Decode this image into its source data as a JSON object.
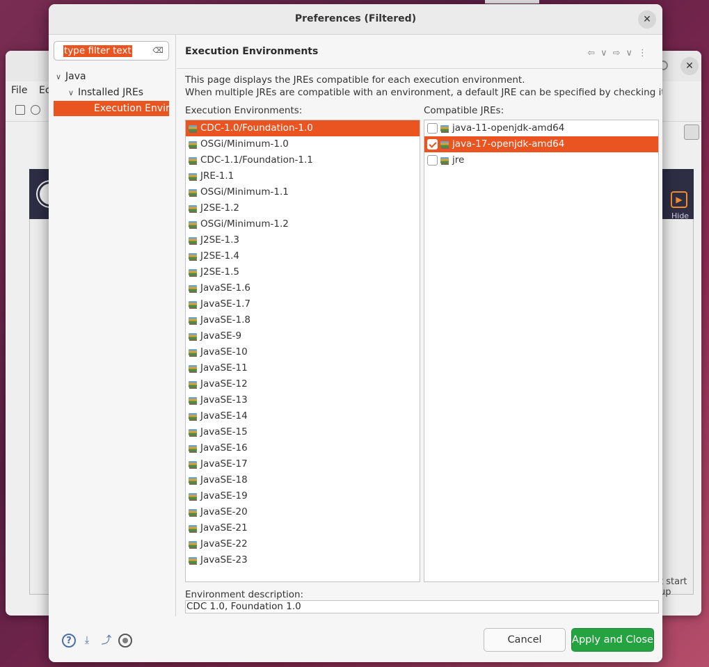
{
  "background_window": {
    "menu": [
      "File",
      "Ec"
    ],
    "hide_label": "Hide",
    "startup_text": "t start up"
  },
  "dialog": {
    "title": "Preferences (Filtered)",
    "close_glyph": "✕"
  },
  "nav": {
    "filter_placeholder": "type filter text",
    "tree": [
      {
        "label": "Java",
        "expanded": true
      },
      {
        "label": "Installed JREs",
        "expanded": true
      },
      {
        "label": "Execution Enviro",
        "selected": true
      }
    ]
  },
  "main": {
    "title": "Execution Environments",
    "description_line1": "This page displays the JREs compatible for each execution environment.",
    "description_line2": "When multiple JREs are compatible with an environment, a default JRE can be specified by checking it.",
    "environments_label": "Execution Environments:",
    "jres_label": "Compatible JREs:",
    "environments": [
      "CDC-1.0/Foundation-1.0",
      "OSGi/Minimum-1.0",
      "CDC-1.1/Foundation-1.1",
      "JRE-1.1",
      "OSGi/Minimum-1.1",
      "J2SE-1.2",
      "OSGi/Minimum-1.2",
      "J2SE-1.3",
      "J2SE-1.4",
      "J2SE-1.5",
      "JavaSE-1.6",
      "JavaSE-1.7",
      "JavaSE-1.8",
      "JavaSE-9",
      "JavaSE-10",
      "JavaSE-11",
      "JavaSE-12",
      "JavaSE-13",
      "JavaSE-14",
      "JavaSE-15",
      "JavaSE-16",
      "JavaSE-17",
      "JavaSE-18",
      "JavaSE-19",
      "JavaSE-20",
      "JavaSE-21",
      "JavaSE-22",
      "JavaSE-23"
    ],
    "selected_environment": "CDC-1.0/Foundation-1.0",
    "jres": [
      {
        "label": "java-11-openjdk-amd64",
        "checked": false,
        "selected": false
      },
      {
        "label": "java-17-openjdk-amd64",
        "checked": true,
        "selected": true
      },
      {
        "label": "jre",
        "checked": false,
        "selected": false
      }
    ],
    "env_description_label": "Environment description:",
    "env_description_value": "CDC 1.0, Foundation 1.0"
  },
  "buttons": {
    "cancel": "Cancel",
    "apply_close": "Apply and Close"
  },
  "colors": {
    "selection": "#e95420",
    "apply_button": "#25a340"
  }
}
